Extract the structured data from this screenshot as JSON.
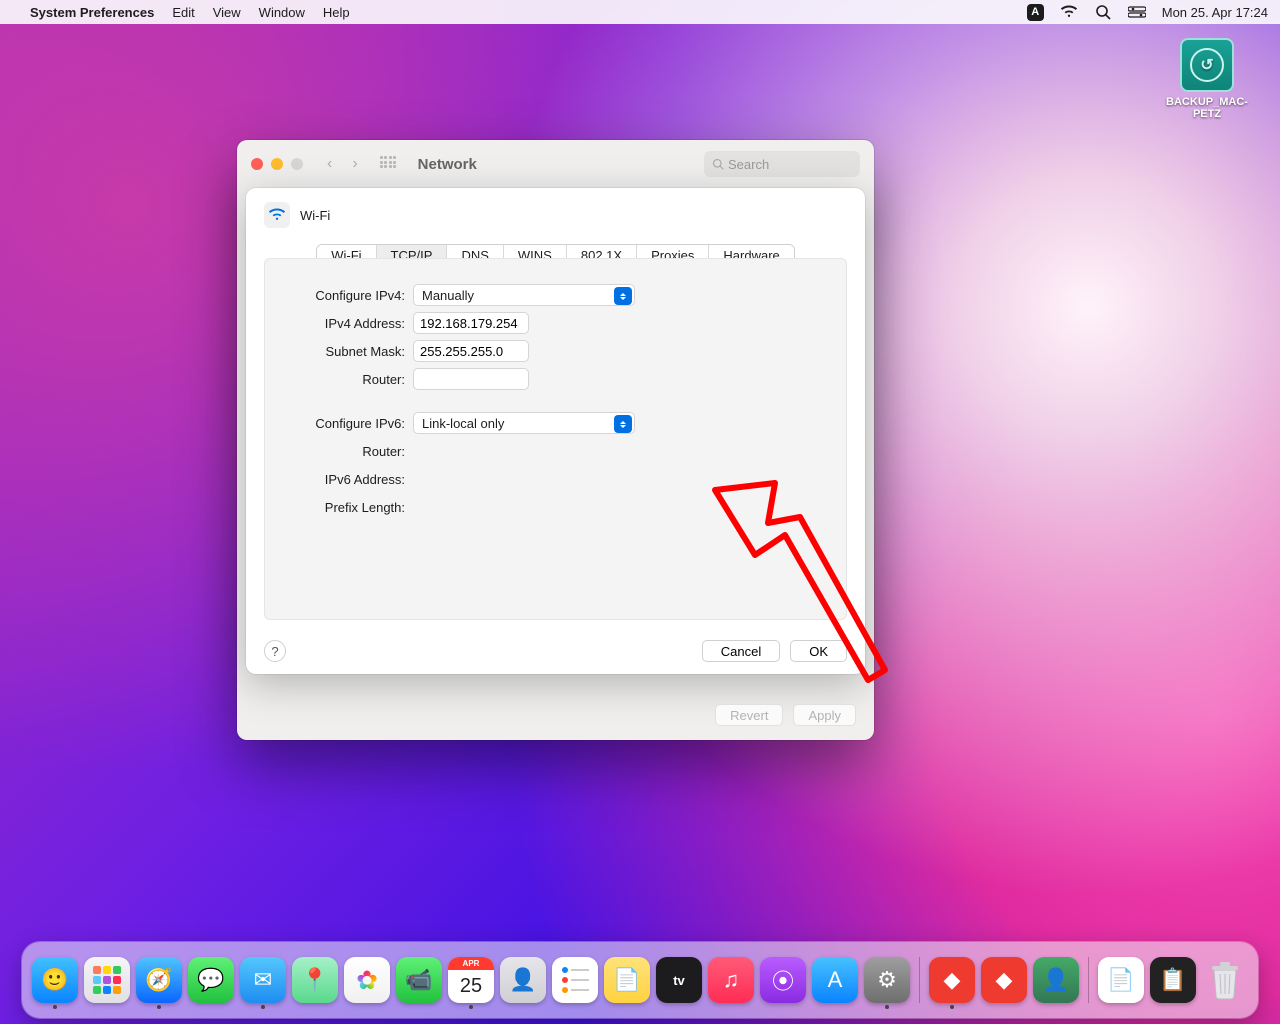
{
  "menubar": {
    "app_name": "System Preferences",
    "menus": [
      "Edit",
      "View",
      "Window",
      "Help"
    ],
    "datetime": "Mon 25. Apr  17:24"
  },
  "desktop_icon": {
    "label": "BACKUP_MAC-PETZ"
  },
  "window": {
    "title": "Network",
    "search_placeholder": "Search",
    "buttons": {
      "revert": "Revert",
      "apply": "Apply"
    }
  },
  "sheet": {
    "interface": "Wi-Fi",
    "tabs": [
      "Wi-Fi",
      "TCP/IP",
      "DNS",
      "WINS",
      "802.1X",
      "Proxies",
      "Hardware"
    ],
    "active_tab": "TCP/IP",
    "labels": {
      "configure_ipv4": "Configure IPv4:",
      "ipv4_address": "IPv4 Address:",
      "subnet_mask": "Subnet Mask:",
      "router4": "Router:",
      "configure_ipv6": "Configure IPv6:",
      "router6": "Router:",
      "ipv6_address": "IPv6 Address:",
      "prefix_length": "Prefix Length:"
    },
    "values": {
      "configure_ipv4": "Manually",
      "ipv4_address": "192.168.179.254",
      "subnet_mask": "255.255.255.0",
      "router4": "",
      "configure_ipv6": "Link-local only",
      "router6": "",
      "ipv6_address": "",
      "prefix_length": ""
    },
    "buttons": {
      "cancel": "Cancel",
      "ok": "OK",
      "help": "?"
    }
  },
  "dock": {
    "apps": [
      {
        "name": "finder",
        "color": "linear-gradient(#42c0ff,#0a84ff)",
        "glyph": "🙂",
        "running": true
      },
      {
        "name": "launchpad",
        "color": "linear-gradient(#f5f5f7,#e0e0e5)",
        "glyph": "▦"
      },
      {
        "name": "safari",
        "color": "linear-gradient(#4fc3ff,#0a66ff)",
        "glyph": "🧭",
        "running": true
      },
      {
        "name": "messages",
        "color": "linear-gradient(#5ef177,#22c13e)",
        "glyph": "💬"
      },
      {
        "name": "mail",
        "color": "linear-gradient(#54c7fc,#1e8df2)",
        "glyph": "✉︎",
        "running": true
      },
      {
        "name": "maps",
        "color": "linear-gradient(#a6f0c8,#59d98c)",
        "glyph": "📍"
      },
      {
        "name": "photos",
        "color": "linear-gradient(#fff,#f0f0f0)",
        "glyph": "❀"
      },
      {
        "name": "facetime",
        "color": "linear-gradient(#5ef177,#22c13e)",
        "glyph": "📹"
      },
      {
        "name": "calendar",
        "color": "#fff",
        "glyph": "25",
        "running": true
      },
      {
        "name": "contacts",
        "color": "linear-gradient(#e6e6ea,#cfcfd4)",
        "glyph": "👤"
      },
      {
        "name": "reminders",
        "color": "#fff",
        "glyph": "☰"
      },
      {
        "name": "notes",
        "color": "linear-gradient(#ffe27a,#ffd23f)",
        "glyph": "📄"
      },
      {
        "name": "tv",
        "color": "#1c1c1e",
        "glyph": "tv"
      },
      {
        "name": "music",
        "color": "linear-gradient(#ff5a78,#ff2d55)",
        "glyph": "♫"
      },
      {
        "name": "podcasts",
        "color": "linear-gradient(#b95cff,#8a2be2)",
        "glyph": "⦿"
      },
      {
        "name": "appstore",
        "color": "linear-gradient(#46c2ff,#0a84ff)",
        "glyph": "A"
      },
      {
        "name": "system-preferences",
        "color": "linear-gradient(#9e9e9e,#6e6e6e)",
        "glyph": "⚙︎",
        "running": true
      }
    ],
    "extras": [
      {
        "name": "anydesk",
        "color": "#ef3b2f",
        "glyph": "◆",
        "running": true
      },
      {
        "name": "anydesk2",
        "color": "#ef3b2f",
        "glyph": "◆"
      },
      {
        "name": "user-photo",
        "color": "linear-gradient(#4a6,#375)",
        "glyph": "👤"
      }
    ],
    "docs": [
      {
        "name": "textedit-doc",
        "color": "#fff",
        "glyph": "📄"
      },
      {
        "name": "dark-doc",
        "color": "#222",
        "glyph": "📋"
      }
    ]
  }
}
